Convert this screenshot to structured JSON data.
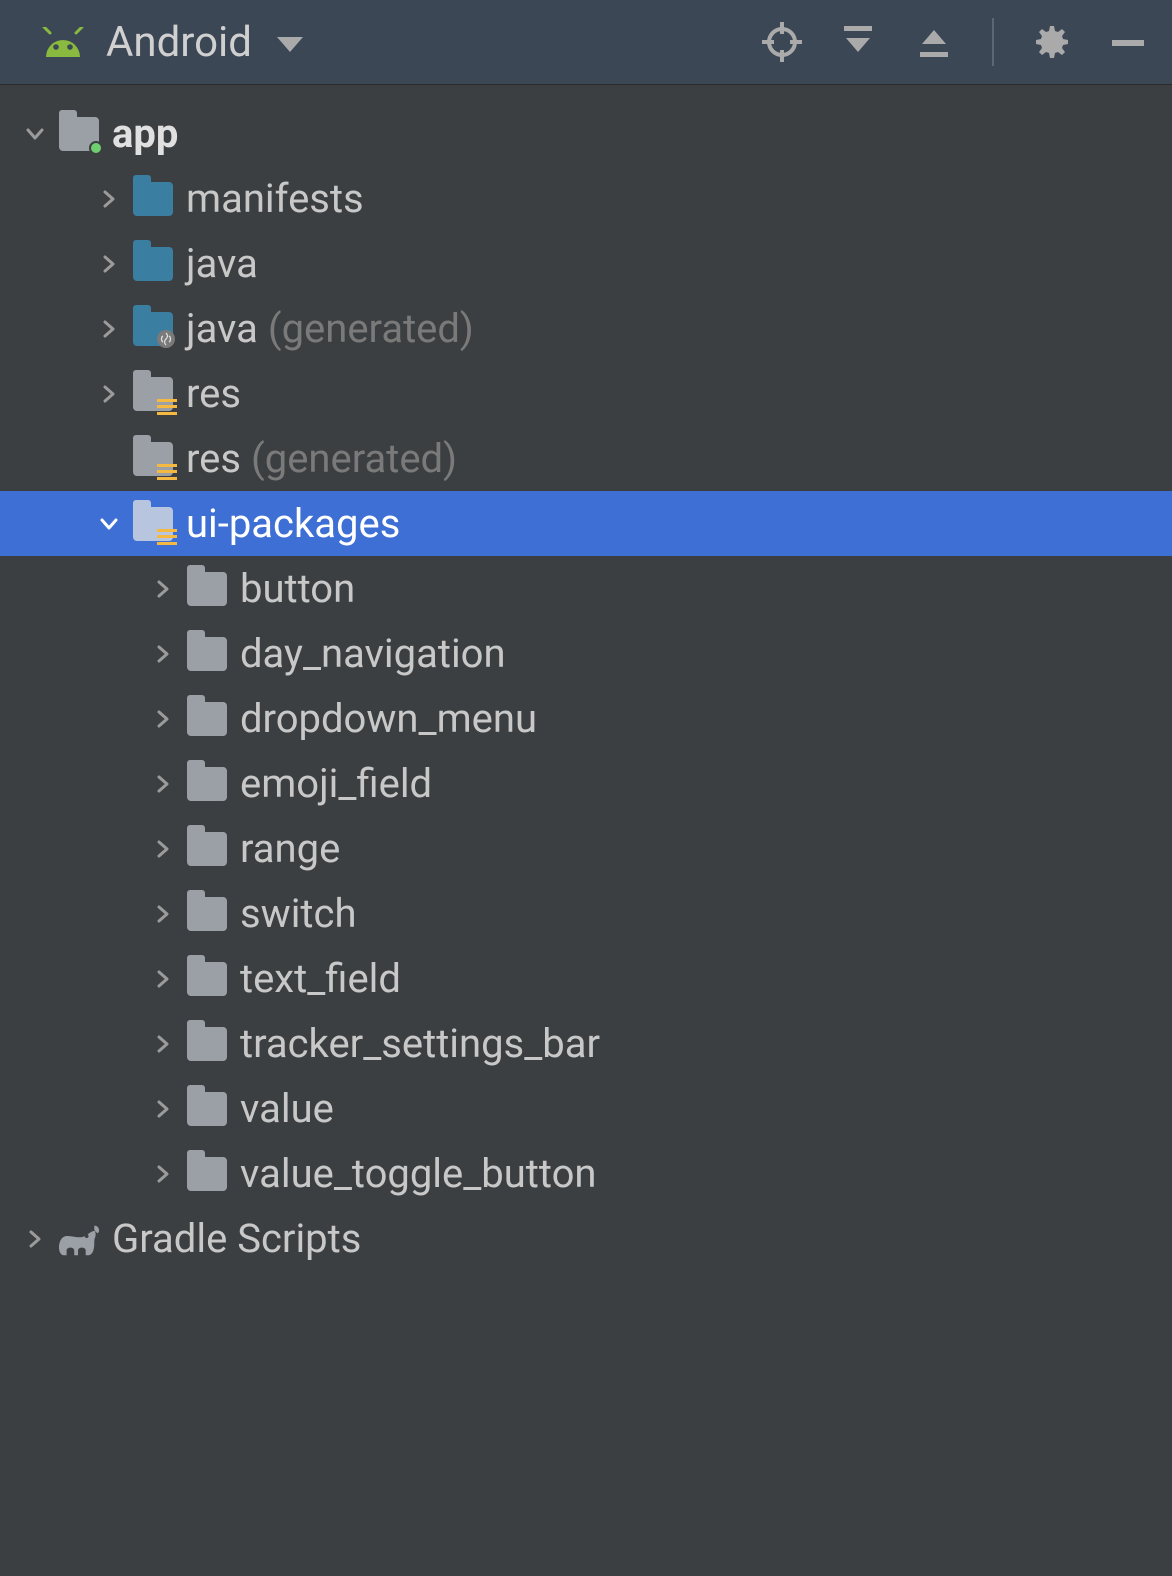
{
  "header": {
    "view_label": "Android"
  },
  "tree": {
    "root": {
      "label": "app",
      "children_a": [
        {
          "label": "manifests",
          "suffix": ""
        },
        {
          "label": "java",
          "suffix": ""
        },
        {
          "label": "java",
          "suffix": "(generated)"
        },
        {
          "label": "res",
          "suffix": ""
        },
        {
          "label": "res",
          "suffix": "(generated)"
        }
      ],
      "ui_packages": {
        "label": "ui-packages",
        "children": [
          {
            "label": "button"
          },
          {
            "label": "day_navigation"
          },
          {
            "label": "dropdown_menu"
          },
          {
            "label": "emoji_field"
          },
          {
            "label": "range"
          },
          {
            "label": "switch"
          },
          {
            "label": "text_field"
          },
          {
            "label": "tracker_settings_bar"
          },
          {
            "label": "value"
          },
          {
            "label": "value_toggle_button"
          }
        ]
      }
    },
    "gradle": {
      "label": "Gradle Scripts"
    }
  }
}
